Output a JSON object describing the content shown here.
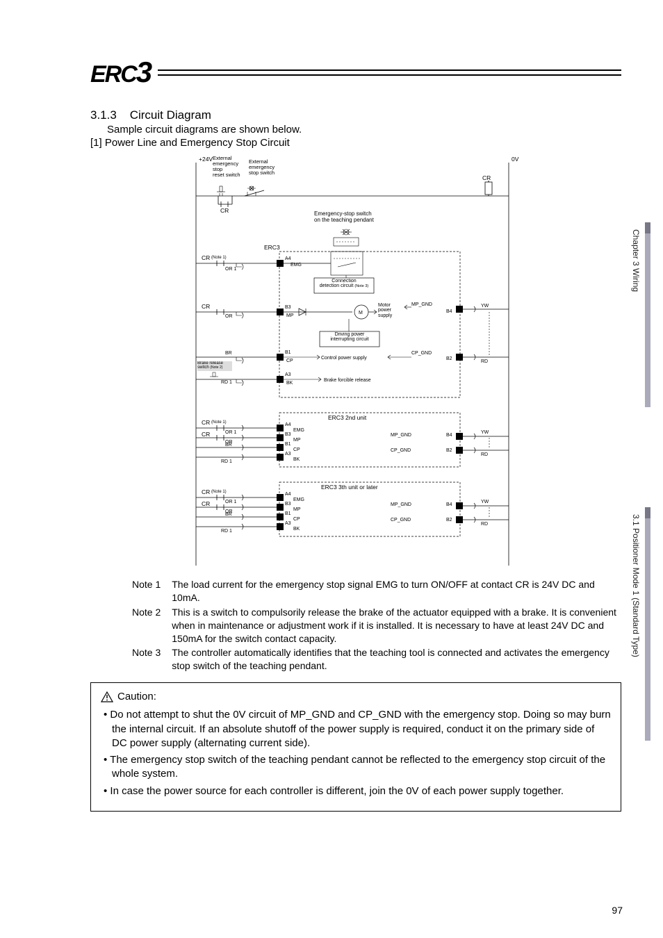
{
  "logo": "ERC3",
  "section_number": "3.1.3",
  "section_title": "Circuit Diagram",
  "section_sub": "Sample circuit diagrams are shown below.",
  "section_part": "[1]  Power Line and Emergency Stop Circuit",
  "sidebar": {
    "chapter": "Chapter 3 Wiring",
    "section": "3.1 Positioner Mode 1 (Standard Type)"
  },
  "diagram": {
    "rail_plus": "+24V",
    "rail_zero": "0V",
    "ext_reset": "External\nemergency\nstop\nreset switch",
    "ext_stop": "External\nemergency\nstop switch",
    "cr_top": "CR",
    "cr_right": "CR",
    "estop_pendant": "Emergency-stop switch\non the teaching pendant",
    "erc3": "ERC3",
    "cr_note1": "CR",
    "note1_super": "(Note 1)",
    "or1": "OR 1",
    "a4": "A4",
    "emg": "EMG",
    "conn_det": "Connection\ndetection circuit",
    "conn_det_note": "(Note 3)",
    "cr_mid": "CR",
    "or_mid": "OR",
    "b3": "B3",
    "mp": "MP",
    "motor_ps": "Motor\npower\nsupply",
    "mp_gnd": "MP_GND",
    "b4": "B4",
    "yw": "YW",
    "drive_int": "Driving power\ninterrupting circuit",
    "b1": "B1",
    "cp": "CP",
    "cps": "Control power supply",
    "cp_gnd": "CP_GND",
    "b2": "B2",
    "rd": "RD",
    "br": "BR",
    "brake_release": "Brake release\nswitch",
    "note2_super": "(Note 2)",
    "rd1": "RD 1",
    "a3": "A3",
    "bk": "BK",
    "brake_forcible": "Brake forcible release",
    "unit2": "ERC3   2nd unit",
    "unit3": "ERC3   3th unit or later"
  },
  "notes": [
    {
      "label": "Note 1",
      "text": "The load current for the emergency stop signal EMG to turn ON/OFF at contact CR is 24V DC and 10mA."
    },
    {
      "label": "Note 2",
      "text": "This is a switch to compulsorily release the brake of the actuator equipped with a brake. It is convenient when in maintenance or adjustment work if it is installed. It is necessary to have at least 24V DC and 150mA for the switch contact capacity."
    },
    {
      "label": "Note 3",
      "text": "The controller automatically identifies that the teaching tool is connected and activates the emergency stop switch of the teaching pendant."
    }
  ],
  "caution_head": "Caution:",
  "caution_items": [
    "Do not attempt to shut the 0V circuit of MP_GND and CP_GND with the emergency stop. Doing so may burn the internal circuit. If an absolute shutoff of the power supply is required, conduct it on the primary side of DC power supply (alternating current side).",
    "The emergency stop switch of the teaching pendant cannot be reflected to the emergency stop circuit of the whole system.",
    "In case the power source for each controller is different, join the 0V of each power supply together."
  ],
  "page_number": "97"
}
